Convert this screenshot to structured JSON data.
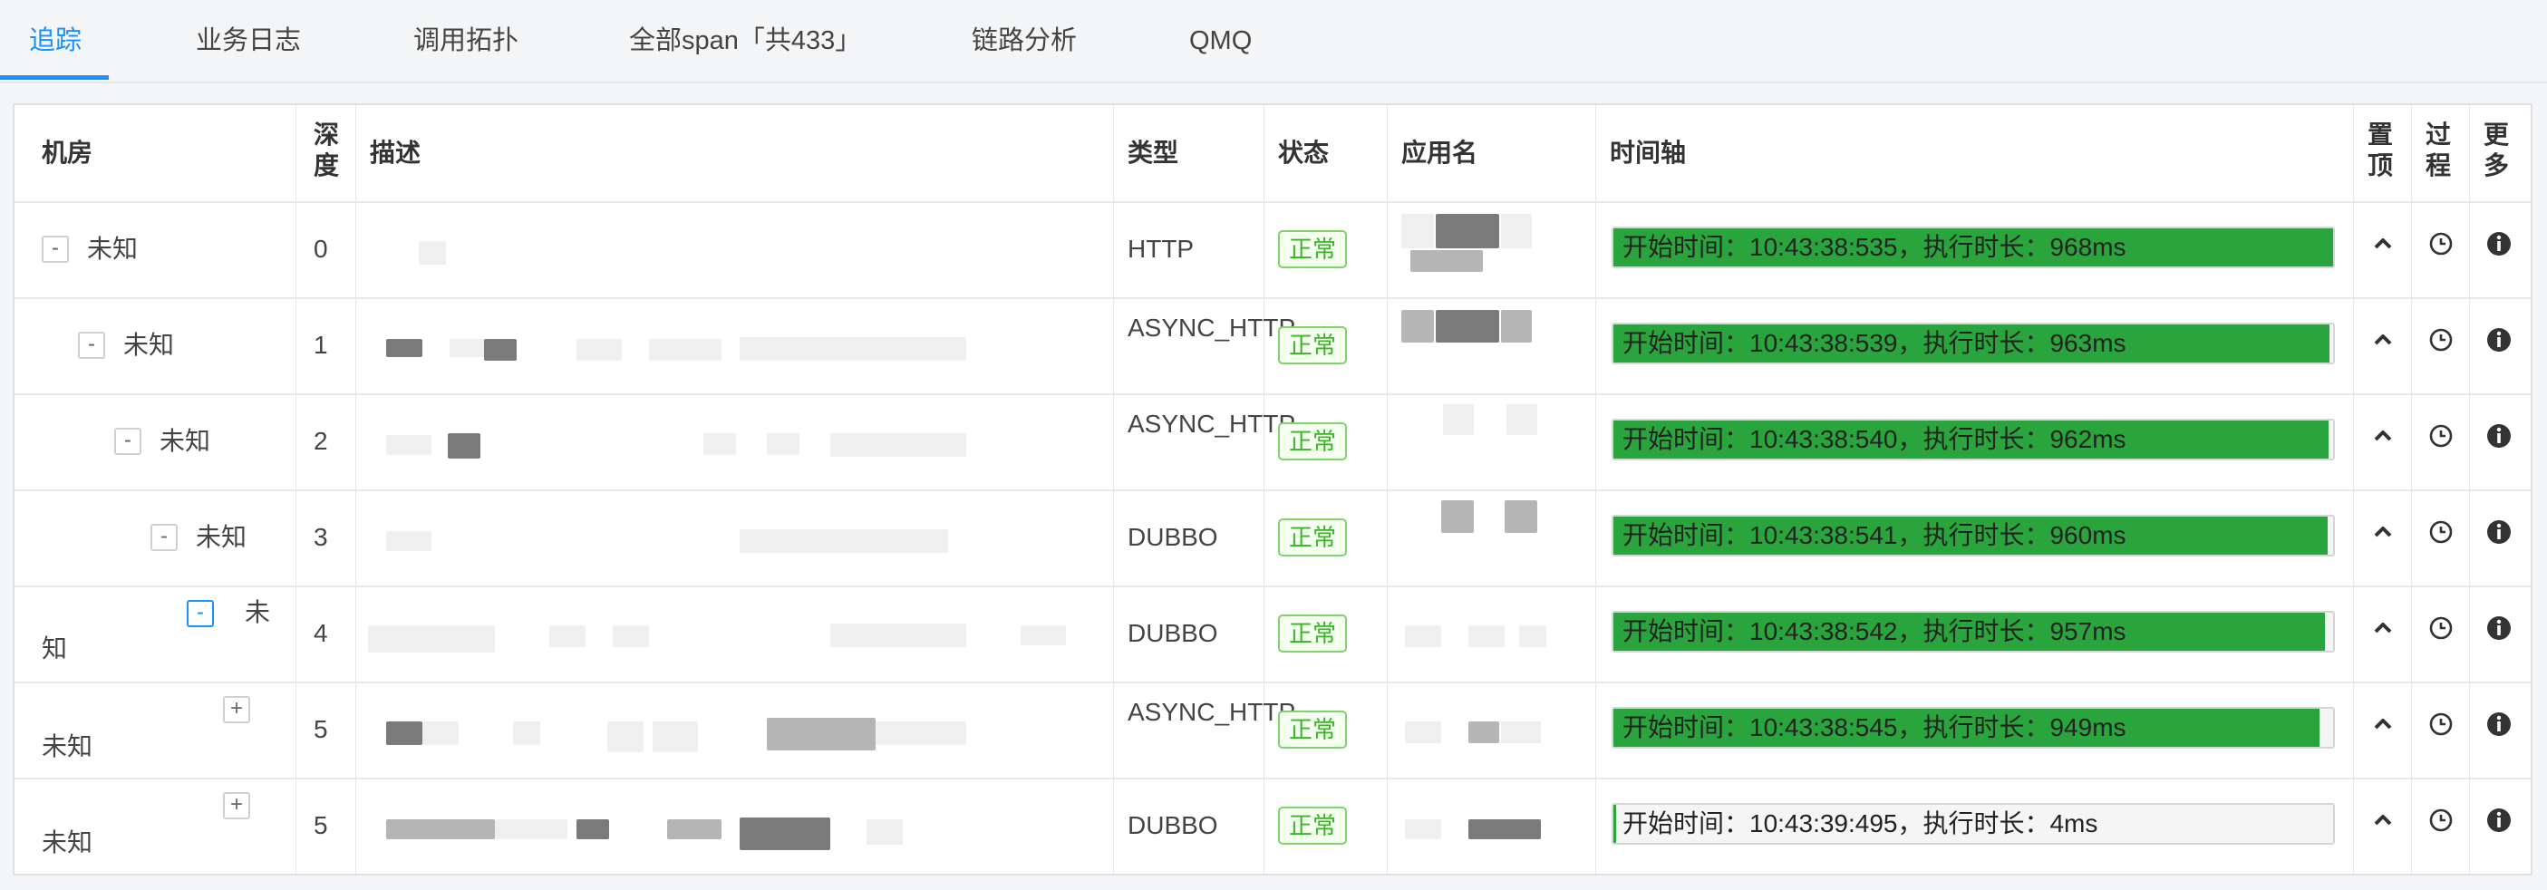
{
  "tabs": [
    {
      "label": "追踪",
      "active": true
    },
    {
      "label": "业务日志"
    },
    {
      "label": "调用拓扑"
    },
    {
      "label": "全部span「共433」"
    },
    {
      "label": "链路分析"
    },
    {
      "label": "QMQ"
    }
  ],
  "table": {
    "headers": {
      "room": "机房",
      "depth": "深度",
      "desc": "描述",
      "type": "类型",
      "status": "状态",
      "app": "应用名",
      "timeline": "时间轴",
      "pin": "置顶",
      "process": "过程",
      "more": "更多"
    },
    "rows": [
      {
        "toggle": "-",
        "room": "未知",
        "depth": "0",
        "type": "HTTP",
        "status": "正常",
        "timeline": "开始时间：10:43:38:535，执行时长：968ms",
        "fill": 1.0
      },
      {
        "toggle": "-",
        "room": "未知",
        "depth": "1",
        "type": "ASYNC_HTTP",
        "status": "正常",
        "timeline": "开始时间：10:43:38:539，执行时长：963ms",
        "fill": 0.995
      },
      {
        "toggle": "-",
        "room": "未知",
        "depth": "2",
        "type": "ASYNC_HTTP",
        "status": "正常",
        "timeline": "开始时间：10:43:38:540，执行时长：962ms",
        "fill": 0.994
      },
      {
        "toggle": "-",
        "room": "未知",
        "depth": "3",
        "type": "DUBBO",
        "status": "正常",
        "timeline": "开始时间：10:43:38:541，执行时长：960ms",
        "fill": 0.992
      },
      {
        "toggle": "-",
        "room": "未知",
        "depth": "4",
        "type": "DUBBO",
        "status": "正常",
        "timeline": "开始时间：10:43:38:542，执行时长：957ms",
        "fill": 0.989
      },
      {
        "toggle": "+",
        "room": "未知",
        "depth": "5",
        "type": "ASYNC_HTTP",
        "status": "正常",
        "timeline": "开始时间：10:43:38:545，执行时长：949ms",
        "fill": 0.981
      },
      {
        "toggle": "+",
        "room": "未知",
        "depth": "5",
        "type": "DUBBO",
        "status": "正常",
        "timeline": "开始时间：10:43:39:495，执行时长：4ms",
        "fill": 0.004
      }
    ]
  },
  "colors": {
    "accent": "#1890ff",
    "bar_green": "#2aa43c",
    "status_green": "#3db22b"
  },
  "icons": {
    "pin": "chevron-up-icon",
    "process": "clock-icon",
    "more": "info-icon"
  }
}
